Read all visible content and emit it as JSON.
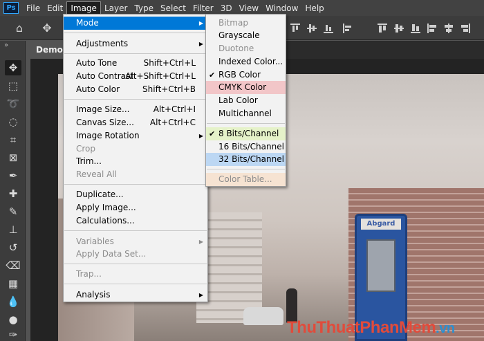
{
  "app": {
    "logo": "Ps"
  },
  "menubar": {
    "items": [
      "File",
      "Edit",
      "Image",
      "Layer",
      "Type",
      "Select",
      "Filter",
      "3D",
      "View",
      "Window",
      "Help"
    ],
    "active": "Image"
  },
  "document": {
    "tab_title": "Demo ("
  },
  "image_menu": {
    "mode": "Mode",
    "adjustments": "Adjustments",
    "auto_tone": "Auto Tone",
    "auto_tone_sc": "Shift+Ctrl+L",
    "auto_contrast": "Auto Contrast",
    "auto_contrast_sc": "Alt+Shift+Ctrl+L",
    "auto_color": "Auto Color",
    "auto_color_sc": "Shift+Ctrl+B",
    "image_size": "Image Size...",
    "image_size_sc": "Alt+Ctrl+I",
    "canvas_size": "Canvas Size...",
    "canvas_size_sc": "Alt+Ctrl+C",
    "image_rotation": "Image Rotation",
    "crop": "Crop",
    "trim": "Trim...",
    "reveal_all": "Reveal All",
    "duplicate": "Duplicate...",
    "apply_image": "Apply Image...",
    "calculations": "Calculations...",
    "variables": "Variables",
    "apply_data_set": "Apply Data Set...",
    "trap": "Trap...",
    "analysis": "Analysis"
  },
  "mode_menu": {
    "bitmap": "Bitmap",
    "grayscale": "Grayscale",
    "duotone": "Duotone",
    "indexed_color": "Indexed Color...",
    "rgb_color": "RGB Color",
    "cmyk_color": "CMYK Color",
    "lab_color": "Lab Color",
    "multichannel": "Multichannel",
    "bits_8": "8 Bits/Channel",
    "bits_16": "16 Bits/Channel",
    "bits_32": "32 Bits/Channel",
    "color_table": "Color Table...",
    "checked": [
      "RGB Color",
      "8 Bits/Channel"
    ]
  },
  "photo": {
    "booth_sign": "Abgard"
  },
  "watermark": {
    "part1": "ThuThuatPhanMem",
    "part2": ".vn"
  },
  "colors": {
    "highlight": "#0078d7",
    "pink": "#f2c6c8",
    "green": "#e5f2c9",
    "blue": "#bcd7f3",
    "peach": "#f6e3d2"
  }
}
